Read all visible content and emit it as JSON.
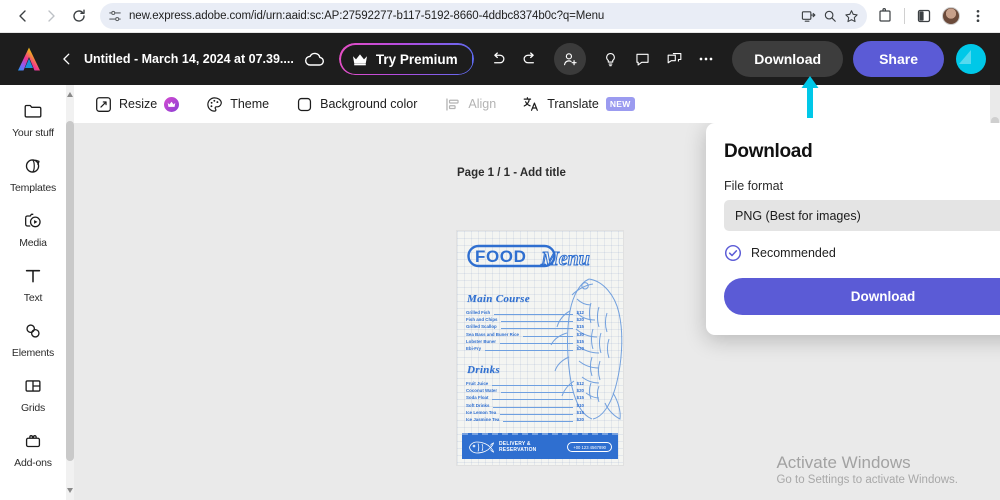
{
  "browser": {
    "url": "new.express.adobe.com/id/urn:aaid:sc:AP:27592277-b117-5192-8660-4ddbc8374b0c?q=Menu",
    "back_icon": "back-arrow-icon",
    "forward_icon": "forward-arrow-icon",
    "reload_icon": "reload-icon",
    "site_settings_icon": "tune-icon",
    "install_icon": "install-app-icon",
    "zoom_icon": "zoom-icon",
    "bookmark_icon": "star-icon",
    "extensions_icon": "extensions-icon",
    "split_icon": "split-screen-icon",
    "profile_icon": "profile-avatar",
    "menu_icon": "three-dot-menu-icon"
  },
  "header": {
    "logo": "adobe-express-logo",
    "back_label": "back-chevron-icon",
    "doc_title": "Untitled - March 14, 2024 at 07.39....",
    "cloud_icon": "cloud-saved-icon",
    "try_premium_label": "Try Premium",
    "crown_icon": "crown-icon",
    "undo_icon": "undo-icon",
    "redo_icon": "redo-icon",
    "invite_icon": "add-person-icon",
    "ideas_icon": "lightbulb-icon",
    "comment_icon": "comment-icon",
    "duplicate_icon": "duplicate-icon",
    "more_icon": "more-options-icon",
    "download_label": "Download",
    "share_label": "Share",
    "avatar": "user-avatar",
    "pointer_icon": "cyan-up-arrow-pointer"
  },
  "sidebar": {
    "items": [
      {
        "label": "Your stuff",
        "icon": "folder-icon"
      },
      {
        "label": "Templates",
        "icon": "templates-icon"
      },
      {
        "label": "Media",
        "icon": "media-icon"
      },
      {
        "label": "Text",
        "icon": "text-icon"
      },
      {
        "label": "Elements",
        "icon": "elements-icon"
      },
      {
        "label": "Grids",
        "icon": "grids-icon"
      },
      {
        "label": "Add-ons",
        "icon": "addons-icon"
      }
    ]
  },
  "toolbar": {
    "resize_label": "Resize",
    "resize_icon": "resize-icon",
    "resize_premium_icon": "premium-crown-badge",
    "theme_label": "Theme",
    "theme_icon": "palette-icon",
    "background_label": "Background color",
    "background_icon": "square-color-icon",
    "align_label": "Align",
    "align_icon": "align-icon",
    "translate_label": "Translate",
    "translate_icon": "translate-icon",
    "translate_badge": "NEW"
  },
  "canvas": {
    "page_label": "Page 1 / 1 - Add title",
    "design": {
      "logo_food": "FOOD",
      "logo_menu": "Menu",
      "sections": [
        {
          "title": "Main Course",
          "items": [
            {
              "name": "Grilled Fish",
              "price": "$12"
            },
            {
              "name": "Fish and Chips",
              "price": "$20"
            },
            {
              "name": "Grilled Scallop",
              "price": "$15"
            },
            {
              "name": "Sea Bass and Buner Rice",
              "price": "$30"
            },
            {
              "name": "Lobster Buner",
              "price": "$15"
            },
            {
              "name": "Ebi-Fry",
              "price": "$20"
            }
          ]
        },
        {
          "title": "Drinks",
          "items": [
            {
              "name": "Fruit Juice",
              "price": "$12"
            },
            {
              "name": "Coconut Water",
              "price": "$20"
            },
            {
              "name": "Soda Float",
              "price": "$15"
            },
            {
              "name": "Soft Drinks",
              "price": "$10"
            },
            {
              "name": "Ice Lemon Tea",
              "price": "$15"
            },
            {
              "name": "Ice Jasmine Tea",
              "price": "$20"
            }
          ]
        }
      ],
      "footer_line1": "DELIVERY &",
      "footer_line2": "RESERVATION",
      "footer_phone": "+00 123 4567890",
      "footer_fish_icon": "fish-icon"
    }
  },
  "download_panel": {
    "title": "Download",
    "file_format_label": "File format",
    "file_format_value": "PNG (Best for images)",
    "chevron_icon": "chevron-down-icon",
    "recommended_label": "Recommended",
    "recommended_icon": "check-circle-icon",
    "button_label": "Download"
  },
  "watermark": {
    "line1": "Activate Windows",
    "line2": "Go to Settings to activate Windows."
  },
  "colors": {
    "accent_purple": "#5b5bd6",
    "header_bg": "#1d1d1d",
    "pointer_cyan": "#00c8e8",
    "menu_blue": "#2f6fd0"
  }
}
